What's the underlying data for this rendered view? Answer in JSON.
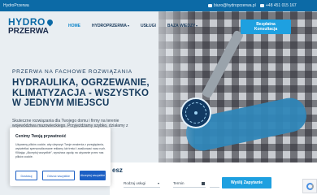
{
  "topbar": {
    "brand": "HydroPrzerwa",
    "email": "biuro@hydroprzerwa.pl",
    "phone": "+48 451 015 167"
  },
  "logo": {
    "line1": "HYDRO",
    "line2": "PRZERWA"
  },
  "nav": {
    "items": [
      {
        "label": "HOME",
        "active": true
      },
      {
        "label": "HYDROPRZERWA",
        "dropdown": true
      },
      {
        "label": "USŁUGI",
        "dropdown": false
      },
      {
        "label": "BAZA WIEDZY",
        "dropdown": true
      }
    ],
    "cta_line1": "Bezpłatna",
    "cta_line2": "Konsultacja"
  },
  "hero": {
    "tagline": "PRZERWA NA FACHOWE ROZWIĄZANIA",
    "headline": "HYDRAULIKA, OGRZEWANIE, KLIMATYZACJA - WSZYSTKO W JEDNYM MIEJSCU",
    "description": "Skuteczne rozwiązania dla Twojego domu i firmy na terenie województwa mazowieckiego. Przyjeżdżamy szybko, działamy z sercem."
  },
  "booking_form": {
    "title": "esz",
    "service_placeholder": "Rodzaj usługi",
    "term_placeholder": "Termin",
    "email_placeholder": "E-mail",
    "submit_label": "Wyślij Zapytanie"
  },
  "cookie_banner": {
    "title": "Cenimy Twoją prywatność",
    "text": "Używamy plików cookie, aby ulepszyć Twoje wrażenia z przeglądania, wyświetlać spersonalizowane reklamy lub treści i analizować nasz ruch. Klikając „Akceptuj wszystkie\", wyrażasz zgodę na używanie przez nas plików cookie.",
    "deny_label": "Dostosuj",
    "prefs_label": "Odrzuć wszystkie",
    "accept_label": "Akceptuj wszystkie"
  },
  "colors": {
    "brand_blue": "#0c6aa6",
    "accent": "#1ea0e0",
    "heading": "#153a5c",
    "cookie_button": "#1c5fc4"
  },
  "icons": [
    "envelope-icon",
    "phone-icon",
    "logo-drop-icon",
    "chevron-down-icon",
    "calendar-icon",
    "recaptcha-icon",
    "certificate-badge-icon"
  ]
}
